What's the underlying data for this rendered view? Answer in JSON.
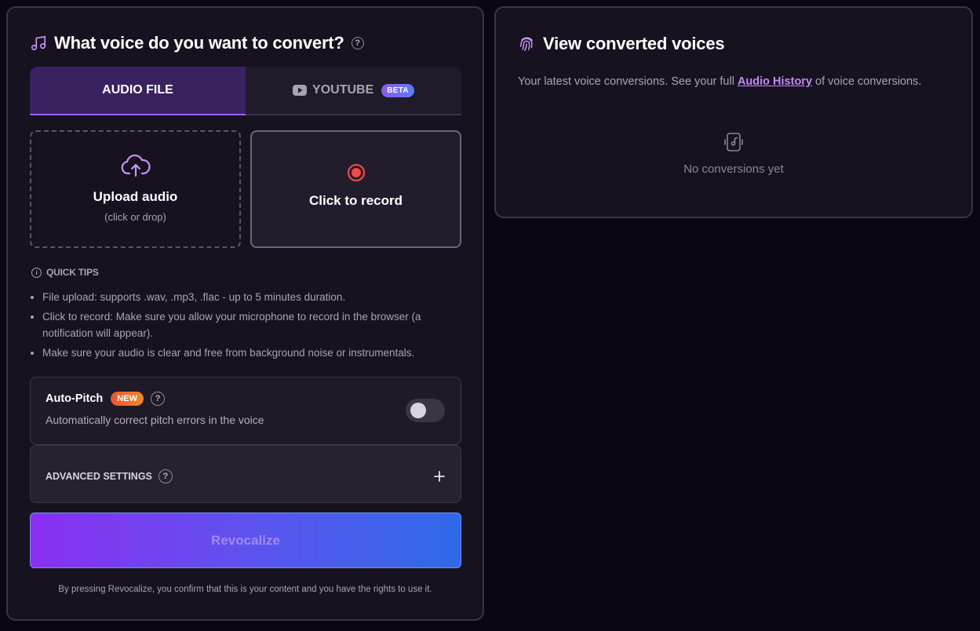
{
  "colors": {
    "accent": "#a35cf5",
    "record_red": "#f04848",
    "gradient_start": "#8b2ff0",
    "gradient_end": "#2e6ae8"
  },
  "convert_panel": {
    "title": "What voice do you want to convert?",
    "title_icon": "music-note-icon",
    "tabs": [
      {
        "label": "AUDIO FILE",
        "active": true
      },
      {
        "label": "YOUTUBE",
        "icon": "youtube-icon",
        "badge": "BETA",
        "active": false
      }
    ],
    "upload": {
      "icon": "cloud-upload-icon",
      "title": "Upload audio",
      "subtitle": "(click or drop)"
    },
    "record": {
      "icon": "record-icon",
      "title": "Click to record"
    },
    "quick_tips": {
      "title": "QUICK TIPS",
      "items": [
        "File upload: supports .wav, .mp3, .flac - up to 5 minutes duration.",
        "Click to record: Make sure you allow your microphone to record in the browser (a notification will appear).",
        "Make sure your audio is clear and free from background noise or instrumentals."
      ]
    },
    "auto_pitch": {
      "title": "Auto-Pitch",
      "badge": "NEW",
      "description": "Automatically correct pitch errors in the voice",
      "enabled": false
    },
    "advanced_settings": {
      "label": "ADVANCED SETTINGS"
    },
    "submit_label": "Revocalize",
    "disclaimer": "By pressing Revocalize, you confirm that this is your content and you have the rights to use it."
  },
  "history_panel": {
    "title": "View converted voices",
    "title_icon": "fingerprint-icon",
    "description_prefix": "Your latest voice conversions. See your full",
    "description_link": "Audio History",
    "description_suffix": "of voice conversions.",
    "empty_icon": "phone-music-icon",
    "empty_text": "No conversions yet"
  }
}
